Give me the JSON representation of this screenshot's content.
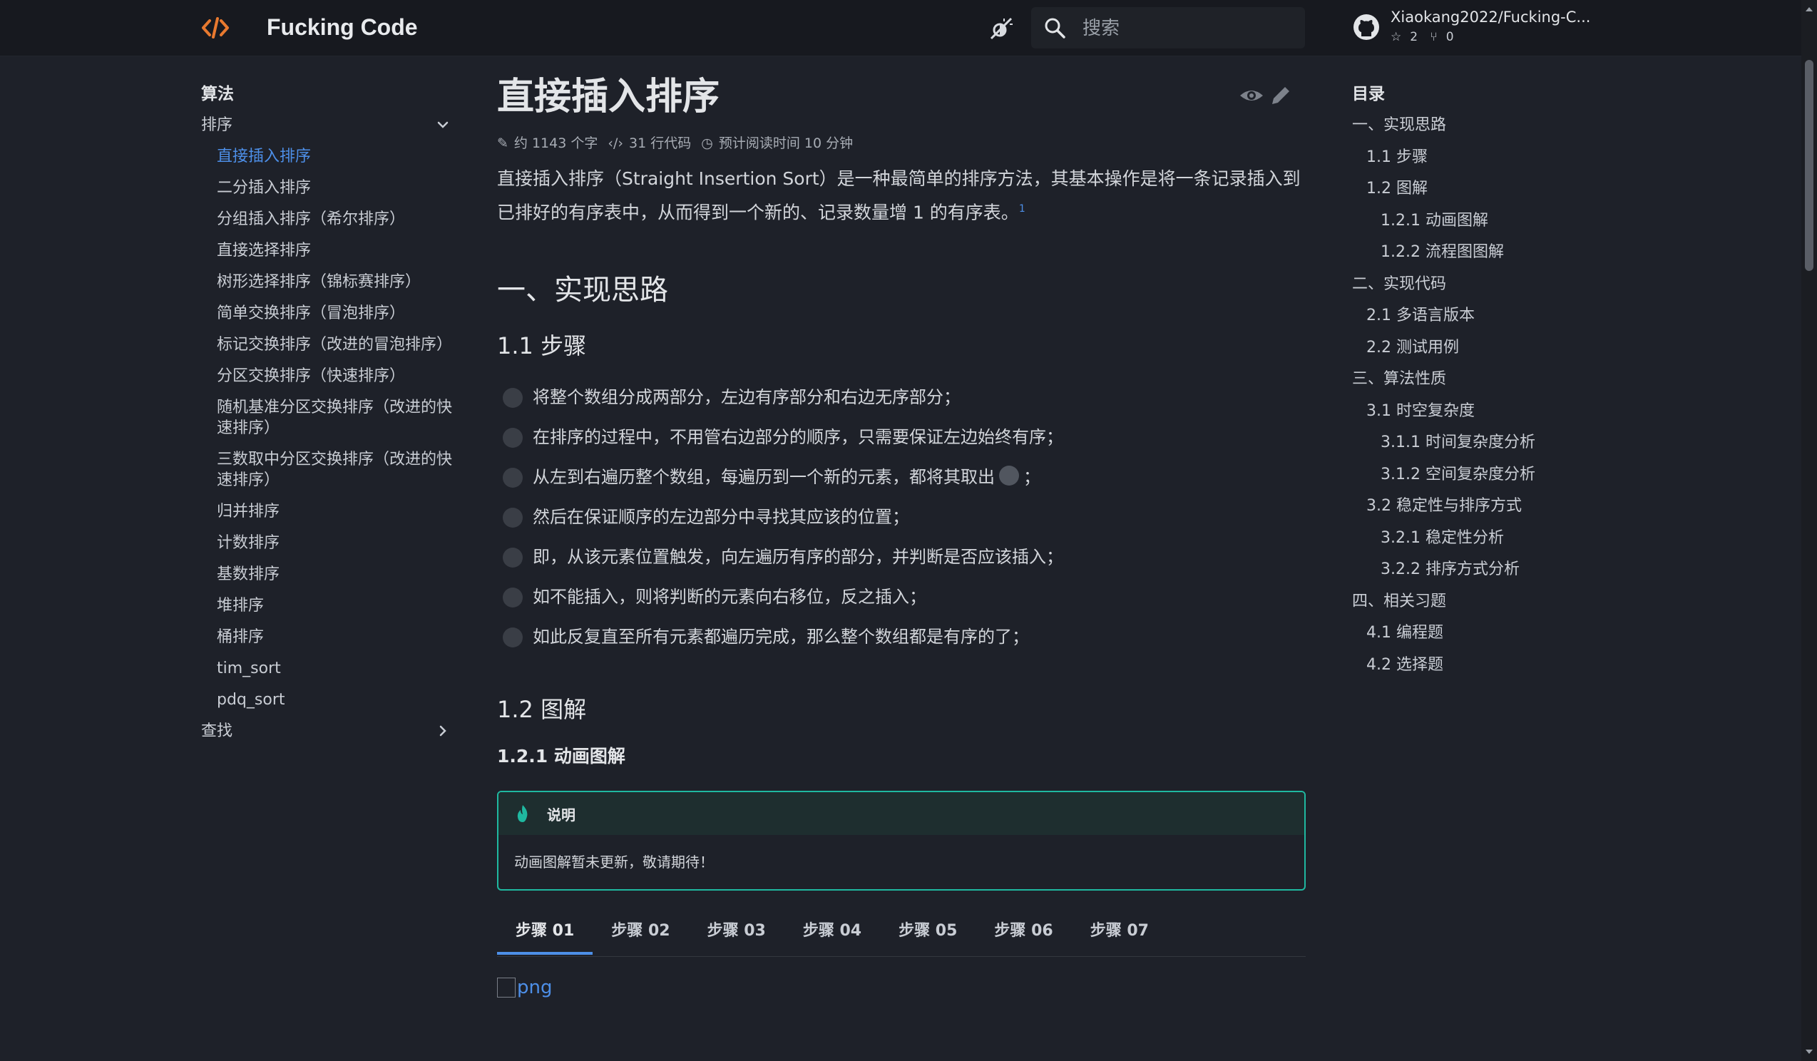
{
  "header": {
    "site_title": "Fucking Code",
    "search_placeholder": "搜索",
    "repo_name": "Xiaokang2022/Fucking-C...",
    "stars": "2",
    "forks": "0",
    "accent_color": "#e8792f"
  },
  "sidebar": {
    "section": "算法",
    "group_sort": "排序",
    "items": [
      "直接插入排序",
      "二分插入排序",
      "分组插入排序（希尔排序）",
      "直接选择排序",
      "树形选择排序（锦标赛排序）",
      "简单交换排序（冒泡排序）",
      "标记交换排序（改进的冒泡排序）",
      "分区交换排序（快速排序）",
      "随机基准分区交换排序（改进的快速排序）",
      "三数取中分区交换排序（改进的快速排序）",
      "归并排序",
      "计数排序",
      "基数排序",
      "堆排序",
      "桶排序",
      "tim_sort",
      "pdq_sort"
    ],
    "group_search": "查找"
  },
  "main": {
    "title": "直接插入排序",
    "meta_words": "约 1143 个字",
    "meta_code": "31 行代码",
    "meta_time": "预计阅读时间 10 分钟",
    "intro": "直接插入排序（Straight Insertion Sort）是一种最简单的排序方法，其基本操作是将一条记录插入到已排好的有序表中，从而得到一个新的、记录数量增 1 的有序表。",
    "footnote": "1",
    "h2_1": "一、实现思路",
    "h3_1": "1.1 步骤",
    "steps": [
      "将整个数组分成两部分，左边有序部分和右边无序部分；",
      "在排序的过程中，不用管右边部分的顺序，只需要保证左边始终有序；",
      "从左到右遍历整个数组，每遍历到一个新的元素，都将其取出",
      "然后在保证顺序的左边部分中寻找其应该的位置；",
      "即，从该元素位置触发，向左遍历有序的部分，并判断是否应该插入；",
      "如不能插入，则将判断的元素向右移位，反之插入；",
      "如此反复直至所有元素都遍历完成，那么整个数组都是有序的了；"
    ],
    "step3_suffix": "；",
    "h3_2": "1.2 图解",
    "h4_1": "1.2.1 动画图解",
    "notice_title": "说明",
    "notice_body": "动画图解暂未更新，敬请期待！",
    "notice_color": "#1fb8a0",
    "tabs": [
      "步骤 01",
      "步骤 02",
      "步骤 03",
      "步骤 04",
      "步骤 05",
      "步骤 06",
      "步骤 07"
    ],
    "image_alt": "png"
  },
  "toc": {
    "title": "目录",
    "items": [
      {
        "level": 1,
        "label": "一、实现思路"
      },
      {
        "level": 2,
        "label": "1.1 步骤"
      },
      {
        "level": 2,
        "label": "1.2 图解"
      },
      {
        "level": 3,
        "label": "1.2.1 动画图解"
      },
      {
        "level": 3,
        "label": "1.2.2 流程图图解"
      },
      {
        "level": 1,
        "label": "二、实现代码"
      },
      {
        "level": 2,
        "label": "2.1 多语言版本"
      },
      {
        "level": 2,
        "label": "2.2 测试用例"
      },
      {
        "level": 1,
        "label": "三、算法性质"
      },
      {
        "level": 2,
        "label": "3.1 时空复杂度"
      },
      {
        "level": 3,
        "label": "3.1.1 时间复杂度分析"
      },
      {
        "level": 3,
        "label": "3.1.2 空间复杂度分析"
      },
      {
        "level": 2,
        "label": "3.2 稳定性与排序方式"
      },
      {
        "level": 3,
        "label": "3.2.1 稳定性分析"
      },
      {
        "level": 3,
        "label": "3.2.2 排序方式分析"
      },
      {
        "level": 1,
        "label": "四、相关习题"
      },
      {
        "level": 2,
        "label": "4.1 编程题"
      },
      {
        "level": 2,
        "label": "4.2 选择题"
      }
    ]
  }
}
